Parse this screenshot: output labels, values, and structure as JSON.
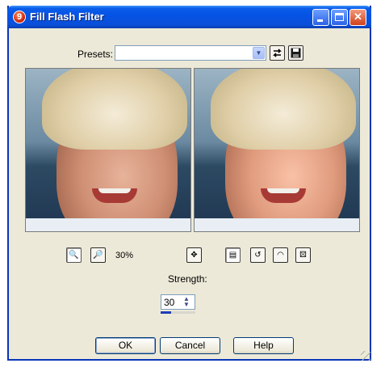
{
  "window": {
    "title": "Fill Flash Filter",
    "app_icon_glyph": "9"
  },
  "presets": {
    "label": "Presets:",
    "selected_value": "",
    "icons": [
      "load-preset-icon",
      "save-preset-icon"
    ]
  },
  "toolbar": {
    "zoom_label": "30%",
    "icons": [
      "zoom-in-icon",
      "zoom-out-icon",
      "pan-icon",
      "proof-icon",
      "reset-icon",
      "default-icon",
      "randomize-icon"
    ]
  },
  "strength": {
    "label": "Strength:",
    "value": "30",
    "fraction": 0.3
  },
  "buttons": {
    "ok": "OK",
    "cancel": "Cancel",
    "help": "Help"
  },
  "colors": {
    "titlebar": "#0553e6",
    "dialog_bg": "#ece9d8",
    "accent": "#1f3db8"
  }
}
